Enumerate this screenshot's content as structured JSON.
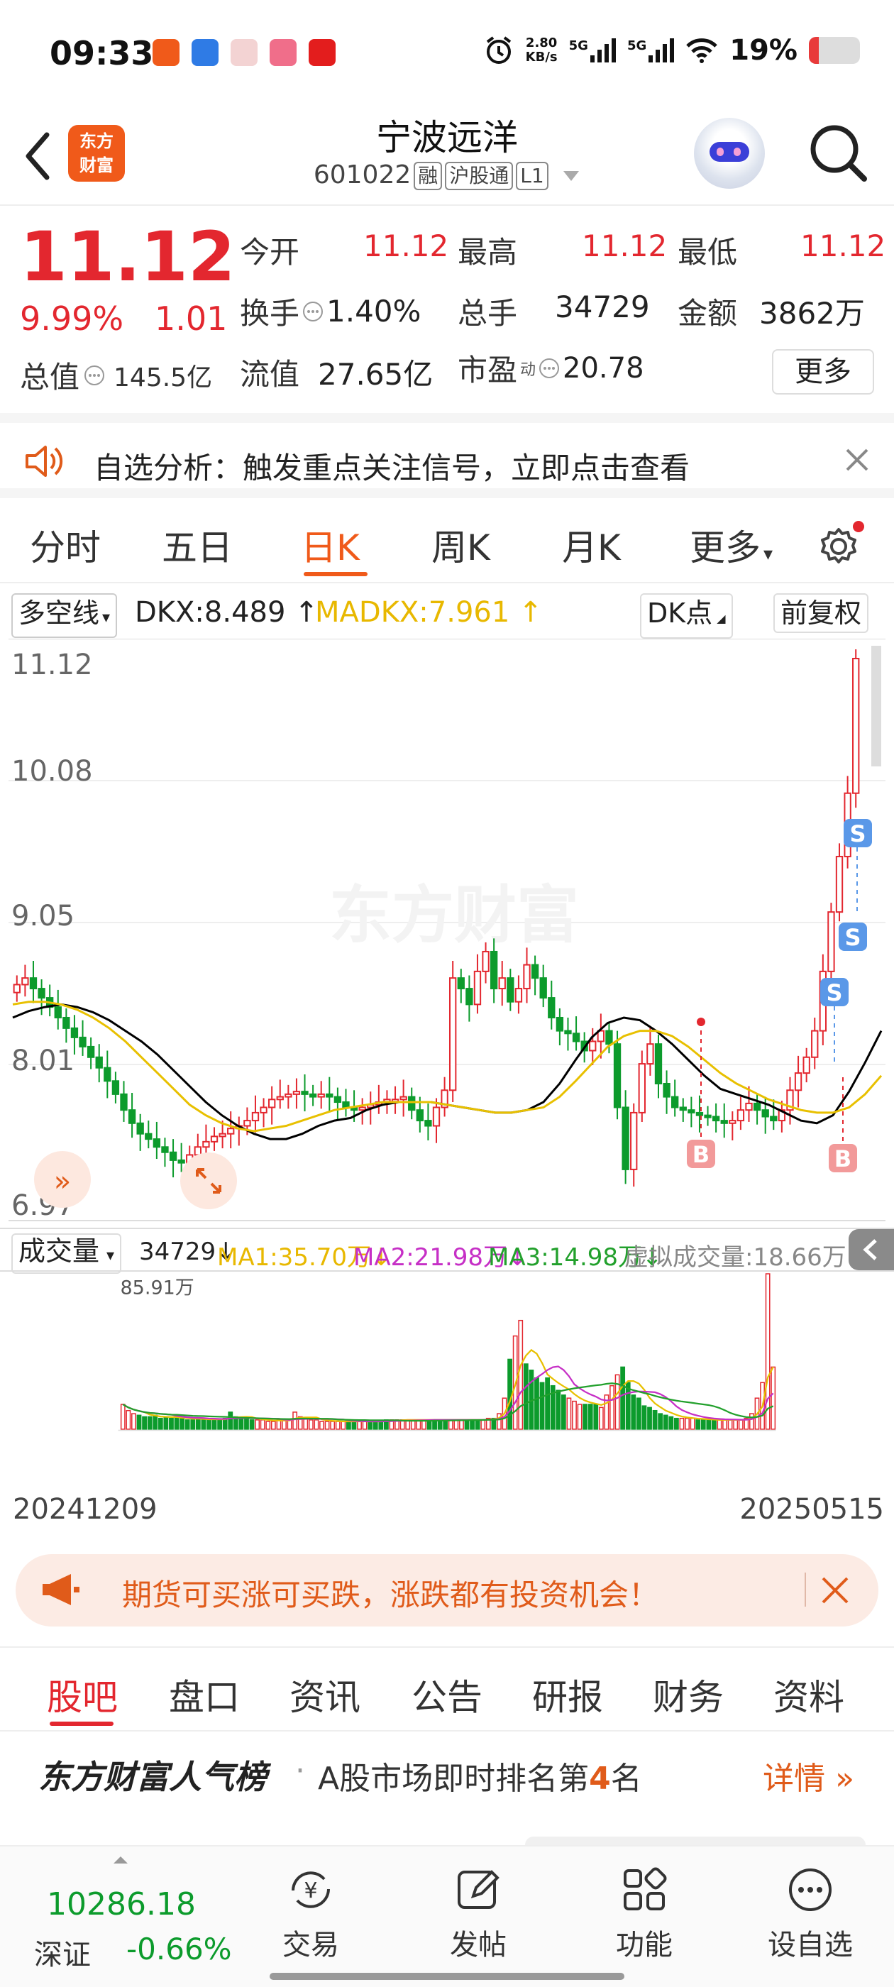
{
  "status_bar": {
    "time": "09:33",
    "net_speed_value": "2.80",
    "net_speed_unit": "KB/s",
    "signal1": "5G",
    "signal2": "5G",
    "battery": "19%",
    "battery_level": 0.19
  },
  "header": {
    "logo_line1": "东方",
    "logo_line2": "财富",
    "stock_name": "宁波远洋",
    "stock_code": "601022",
    "tags": [
      "融",
      "沪股通",
      "L1"
    ]
  },
  "quote": {
    "price": "11.12",
    "change_pct": "9.99%",
    "change": "1.01",
    "total_mv_label": "总值",
    "total_mv": "145.5亿",
    "fields": [
      {
        "label": "今开",
        "value": "11.12"
      },
      {
        "label": "最高",
        "value": "11.12"
      },
      {
        "label": "最低",
        "value": "11.12"
      },
      {
        "label": "换手",
        "value": "1.40%"
      },
      {
        "label": "总手",
        "value": "34729"
      },
      {
        "label": "金额",
        "value": "3862万"
      },
      {
        "label": "流值",
        "value": "27.65亿"
      },
      {
        "label": "市盈",
        "sup": "动",
        "value": "20.78"
      }
    ],
    "more_label": "更多"
  },
  "notice": {
    "text": "自选分析：触发重点关注信号，立即点击查看"
  },
  "period_tabs": [
    "分时",
    "五日",
    "日K",
    "周K",
    "月K",
    "更多"
  ],
  "active_period": "日K",
  "indicator": {
    "selector": "多空线",
    "dkx": "DKX:8.489",
    "madkx": "MADKX:7.961",
    "dk_point": "DK点",
    "adjust": "前复权"
  },
  "chart_data": {
    "type": "candlestick",
    "y_ticks": [
      "11.12",
      "10.08",
      "9.05",
      "8.01",
      "6.97"
    ],
    "ylim": [
      6.97,
      11.12
    ],
    "watermark": "东方财富",
    "markers": [
      "S",
      "S",
      "S",
      "B",
      "B"
    ],
    "volume": {
      "selector": "成交量",
      "current": "34729",
      "ma1": "MA1:35.70万",
      "ma2": "MA2:21.98万",
      "ma3": "MA3:14.98万",
      "virtual": "虚拟成交量:18.66万",
      "max_label": "85.91万"
    },
    "date_start": "20241209",
    "date_end": "20250515",
    "closes": [
      8.65,
      8.7,
      8.62,
      8.55,
      8.48,
      8.4,
      8.32,
      8.25,
      8.18,
      8.1,
      8.02,
      7.92,
      7.82,
      7.7,
      7.6,
      7.52,
      7.48,
      7.42,
      7.38,
      7.32,
      7.3,
      7.36,
      7.42,
      7.46,
      7.5,
      7.52,
      7.56,
      7.58,
      7.62,
      7.68,
      7.72,
      7.78,
      7.8,
      7.82,
      7.84,
      7.82,
      7.8,
      7.82,
      7.8,
      7.76,
      7.72,
      7.7,
      7.72,
      7.74,
      7.76,
      7.78,
      7.78,
      7.8,
      7.7,
      7.62,
      7.58,
      7.72,
      7.85,
      8.7,
      8.62,
      8.5,
      8.75,
      8.9,
      8.62,
      8.7,
      8.52,
      8.62,
      8.8,
      8.7,
      8.55,
      8.4,
      8.3,
      8.28,
      8.22,
      8.15,
      8.22,
      8.3,
      8.2,
      7.72,
      7.25,
      7.68,
      8.05,
      8.2,
      7.9,
      7.8,
      7.72,
      7.7,
      7.68,
      7.66,
      7.65,
      7.62,
      7.6,
      7.62,
      7.7,
      7.75,
      7.7,
      7.65,
      7.62,
      7.7,
      7.85,
      7.98,
      8.1,
      8.3,
      8.75,
      9.2,
      9.62,
      10.1,
      11.12
    ],
    "dkx_line": [
      8.4,
      8.45,
      8.48,
      8.5,
      8.48,
      8.44,
      8.38,
      8.3,
      8.22,
      8.12,
      8.0,
      7.88,
      7.76,
      7.66,
      7.58,
      7.52,
      7.48,
      7.48,
      7.52,
      7.58,
      7.62,
      7.64,
      7.7,
      7.74,
      7.76,
      7.76,
      7.76,
      7.74,
      7.72,
      7.7,
      7.68,
      7.68,
      7.7,
      7.76,
      7.9,
      8.08,
      8.25,
      8.36,
      8.4,
      8.38,
      8.3,
      8.2,
      8.08,
      7.96,
      7.86,
      7.82,
      7.78,
      7.74,
      7.68,
      7.62,
      7.6,
      7.66,
      7.84,
      8.06,
      8.3
    ],
    "madkx_line": [
      8.5,
      8.52,
      8.52,
      8.5,
      8.46,
      8.4,
      8.32,
      8.22,
      8.1,
      7.98,
      7.86,
      7.74,
      7.66,
      7.6,
      7.56,
      7.54,
      7.56,
      7.58,
      7.62,
      7.66,
      7.7,
      7.72,
      7.74,
      7.76,
      7.76,
      7.76,
      7.76,
      7.74,
      7.72,
      7.7,
      7.68,
      7.68,
      7.7,
      7.72,
      7.8,
      7.92,
      8.05,
      8.18,
      8.26,
      8.3,
      8.3,
      8.26,
      8.18,
      8.08,
      7.98,
      7.9,
      7.84,
      7.78,
      7.74,
      7.7,
      7.68,
      7.68,
      7.72,
      7.82,
      7.96
    ],
    "volumes": [
      0.16,
      0.12,
      0.1,
      0.09,
      0.08,
      0.08,
      0.09,
      0.07,
      0.08,
      0.07,
      0.08,
      0.07,
      0.06,
      0.06,
      0.07,
      0.07,
      0.06,
      0.06,
      0.06,
      0.07,
      0.11,
      0.08,
      0.07,
      0.07,
      0.06,
      0.06,
      0.06,
      0.05,
      0.05,
      0.06,
      0.06,
      0.06,
      0.11,
      0.08,
      0.07,
      0.06,
      0.06,
      0.05,
      0.05,
      0.05,
      0.05,
      0.05,
      0.05,
      0.05,
      0.05,
      0.05,
      0.05,
      0.05,
      0.05,
      0.06,
      0.06,
      0.06,
      0.06,
      0.06,
      0.06,
      0.06,
      0.06,
      0.06,
      0.06,
      0.06,
      0.06,
      0.06,
      0.06,
      0.06,
      0.06,
      0.06,
      0.06,
      0.06,
      0.07,
      0.07,
      0.1,
      0.2,
      0.45,
      0.6,
      0.7,
      0.42,
      0.38,
      0.33,
      0.3,
      0.33,
      0.28,
      0.25,
      0.22,
      0.2,
      0.18,
      0.16,
      0.16,
      0.16,
      0.16,
      0.14,
      0.22,
      0.28,
      0.35,
      0.4,
      0.3,
      0.22,
      0.2,
      0.15,
      0.14,
      0.12,
      0.1,
      0.09,
      0.08,
      0.07,
      0.07,
      0.07,
      0.07,
      0.06,
      0.06,
      0.06,
      0.06,
      0.06,
      0.06,
      0.06,
      0.06,
      0.06,
      0.07,
      0.1,
      0.2,
      0.3,
      1.0,
      0.4
    ]
  },
  "ad": {
    "text": "期货可买涨可买跌，涨跌都有投资机会！"
  },
  "bottom_tabs": [
    "股吧",
    "盘口",
    "资讯",
    "公告",
    "研报",
    "财务",
    "资料"
  ],
  "active_bottom_tab": "股吧",
  "rank": {
    "title": "东方财富人气榜",
    "text_prefix": "A股市场即时排名第",
    "rank": "4",
    "text_suffix": "名",
    "detail": "详情"
  },
  "bottom_nav": {
    "index_value": "10286.18",
    "index_name": "深证",
    "index_change": "-0.66%",
    "items": [
      "交易",
      "发帖",
      "功能",
      "设自选"
    ]
  },
  "colors": {
    "up": "#e3272f",
    "down": "#0c9b2c",
    "brand": "#f05a1a",
    "dkx": "#000000",
    "madkx": "#e8c000",
    "ma1": "#e8c000",
    "ma2": "#c62fc6",
    "ma3": "#22a02c"
  }
}
